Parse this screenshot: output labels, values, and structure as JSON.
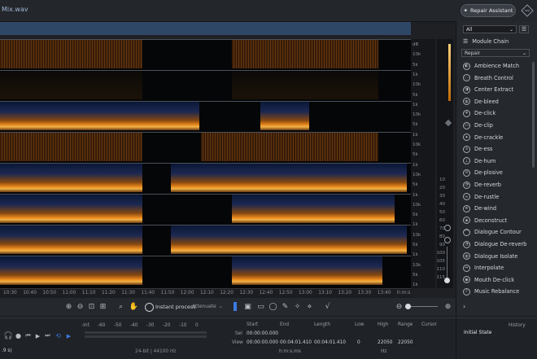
{
  "header": {
    "filename": "Mix.wav",
    "repair_assistant": "Repair Assistant"
  },
  "db_scale": [
    "dB",
    "10k",
    "5k",
    "1k",
    "10k",
    "5k",
    "1k",
    "10k",
    "5k",
    "1k",
    "10k",
    "5k",
    "1k",
    "10k",
    "5k",
    "1k",
    "10k",
    "5k",
    "1k",
    "10k",
    "5k",
    "1k",
    "10k",
    "5k",
    "1k"
  ],
  "meter_ticks": [
    "10",
    "20",
    "30",
    "40",
    "50",
    "60",
    "70",
    "80",
    "90",
    "100",
    "105",
    "110",
    "115"
  ],
  "timeline": [
    "10:30",
    "10:40",
    "10:50",
    "11:00",
    "11:10",
    "11:20",
    "11:30",
    "11:40",
    "11:50",
    "12:00",
    "12:10",
    "12:20",
    "12:30",
    "12:40",
    "12:50",
    "13:00",
    "13:10",
    "13:20",
    "13:30",
    "13:40",
    "h:m:s"
  ],
  "toolbar": {
    "instant_process": "Instant process",
    "attenuate": "Attenuate"
  },
  "transport": {
    "meter_labels": [
      "-Inf.",
      "-60",
      "-50",
      "-40",
      "-30",
      "-20",
      "-10",
      "0"
    ],
    "format": "24-bit | 44100 Hz",
    "time_readout": ".9 s)",
    "start_label": "Start",
    "end_label": "End",
    "length_label": "Length",
    "low_label": "Low",
    "high_label": "High",
    "range_label": "Range",
    "cursor_label": "Cursor",
    "sel_label": "Sel",
    "view_label": "View",
    "sel_start": "00:00:00.000",
    "sel_end": "",
    "sel_length": "",
    "view_start": "00:00:00.000",
    "view_end": "00:04:01.410",
    "view_length": "00:04:01.410",
    "end_sel": "00:04:01.410",
    "len_sel": "00:04:01.410",
    "low": "0",
    "high": "22050",
    "range": "22050",
    "hms": "h:m:s.ms",
    "hz": "Hz"
  },
  "panel": {
    "filter": "All",
    "module_chain": "Module Chain",
    "category": "Repair",
    "modules": [
      "Ambience Match",
      "Breath Control",
      "Center Extract",
      "De-bleed",
      "De-click",
      "De-clip",
      "De-crackle",
      "De-ess",
      "De-hum",
      "De-plosive",
      "De-reverb",
      "De-rustle",
      "De-wind",
      "Deconstruct",
      "Dialogue Contour",
      "Dialogue De-reverb",
      "Dialogue Isolate",
      "Interpolate",
      "Mouth De-click",
      "Music Rebalance"
    ]
  },
  "history": {
    "title": "History",
    "item": "Initial State"
  },
  "colors": {
    "accent": "#f08a1c",
    "spectro_bg": "#050608",
    "blue": "#2f4766"
  }
}
